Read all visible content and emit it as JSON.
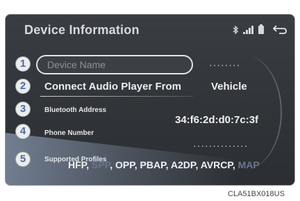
{
  "screen": {
    "title": "Device Information"
  },
  "status_bar": {
    "icons": [
      "bluetooth-icon",
      "signal-icon",
      "battery-icon"
    ],
    "back_icon": "back-arrow-icon"
  },
  "rows": {
    "device_name": {
      "number": "1",
      "placeholder": "Device Name",
      "value": "········"
    },
    "connect_audio": {
      "number": "2",
      "label": "Connect Audio Player From",
      "value": "Vehicle"
    },
    "bluetooth_address": {
      "number": "3",
      "label": "Bluetooth Address",
      "value": "34:f6:2d:d0:7c:3f"
    },
    "phone_number": {
      "number": "4",
      "label": "Phone Number",
      "value": "··············"
    },
    "supported_profiles": {
      "number": "5",
      "label": "Supported Profiles",
      "hfp": "HFP",
      "spp": "SPP",
      "opp": "OPP",
      "pbap": "PBAP",
      "a2dp": "A2DP",
      "avrcp": "AVRCP",
      "map": "MAP",
      "sep": ", "
    }
  },
  "caption": "CLA51BX018US"
}
